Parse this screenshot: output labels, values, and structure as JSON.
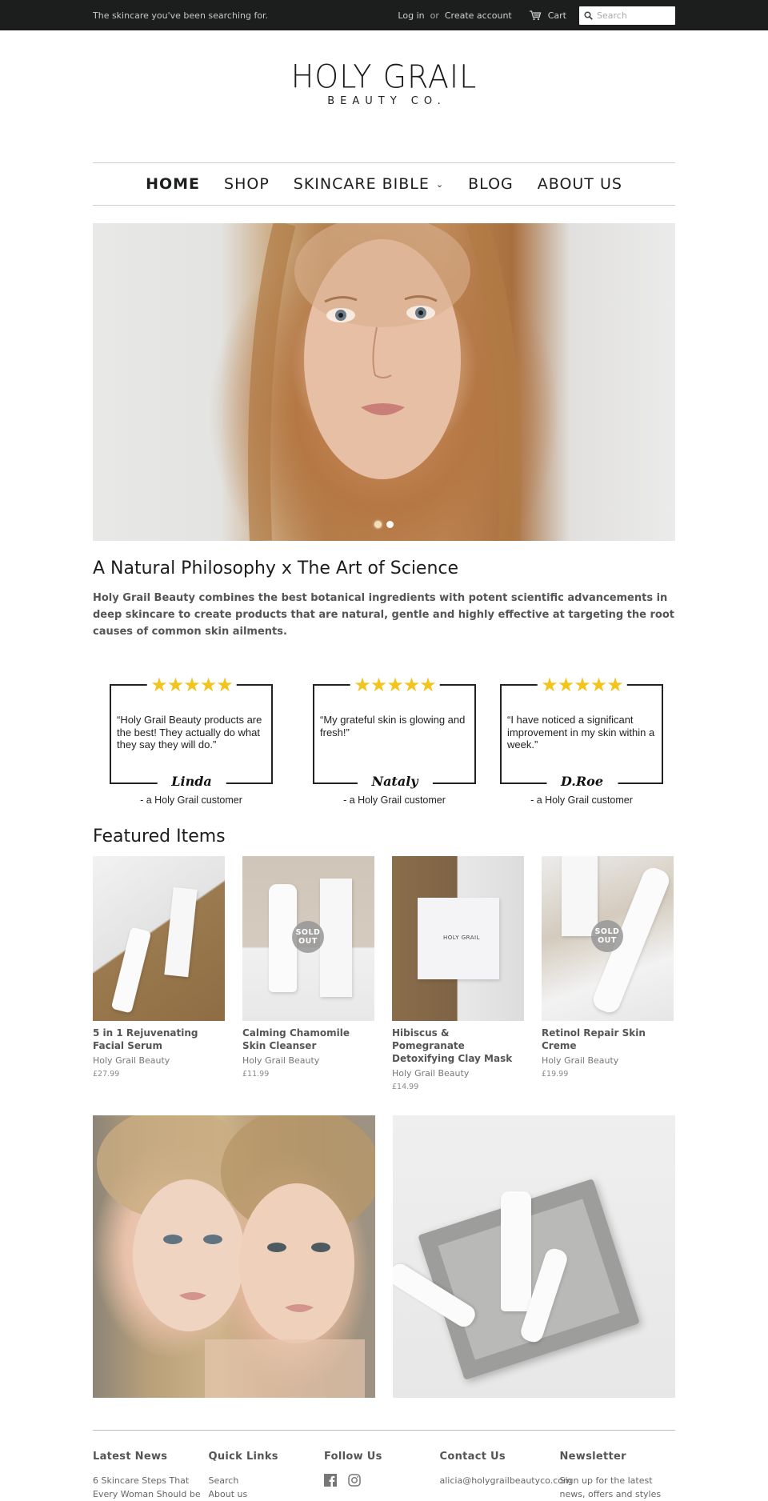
{
  "topbar": {
    "tagline": "The skincare you've been searching for.",
    "login": "Log in",
    "or": "or",
    "create_account": "Create account",
    "cart": "Cart",
    "search_placeholder": "Search"
  },
  "logo": {
    "line1": "HOLY GRAIL",
    "line2": "BEAUTY CO."
  },
  "nav": {
    "items": [
      {
        "label": "HOME",
        "active": true
      },
      {
        "label": "SHOP"
      },
      {
        "label": "SKINCARE BIBLE",
        "dropdown": true
      },
      {
        "label": "BLOG"
      },
      {
        "label": "ABOUT US"
      }
    ]
  },
  "hero": {
    "slides": 2,
    "active_slide": 1
  },
  "intro": {
    "heading": "A Natural Philosophy x The Art of Science",
    "body": "Holy Grail Beauty combines the best botanical ingredients with potent scientific advancements in deep skincare to create products that are natural, gentle and highly effective at targeting the root causes of common skin ailments."
  },
  "testimonials": [
    {
      "stars": "★★★★★",
      "rating": 5,
      "quote": "“Holy Grail Beauty products are the best! They actually do what they say they will do.”",
      "name": "Linda",
      "byline": "- a Holy Grail customer"
    },
    {
      "stars": "★★★★★",
      "rating": 5,
      "quote": "“My grateful skin is glowing and fresh!”",
      "name": "Nataly",
      "byline": "- a Holy Grail customer"
    },
    {
      "stars": "★★★★★",
      "rating": 5,
      "quote": "“I have noticed a significant improvement in my skin within a week.”",
      "name": "D.Roe",
      "byline": "- a Holy Grail customer"
    }
  ],
  "featured": {
    "heading": "Featured Items",
    "sold_out_label_1": "SOLD",
    "sold_out_label_2": "OUT",
    "brand_mark": "HOLY GRAIL",
    "products": [
      {
        "title": "5 in 1 Rejuvenating Facial Serum",
        "vendor": "Holy Grail Beauty",
        "price": "£27.99",
        "sold_out": false
      },
      {
        "title": "Calming Chamomile Skin Cleanser",
        "vendor": "Holy Grail Beauty",
        "price": "£11.99",
        "sold_out": true
      },
      {
        "title": "Hibiscus & Pomegranate Detoxifying Clay Mask",
        "vendor": "Holy Grail Beauty",
        "price": "£14.99",
        "sold_out": false
      },
      {
        "title": "Retinol Repair Skin Creme",
        "vendor": "Holy Grail Beauty",
        "price": "£19.99",
        "sold_out": true
      }
    ]
  },
  "footer": {
    "latest_news": {
      "heading": "Latest News",
      "item": "6 Skincare Steps That Every Woman Should be"
    },
    "quick_links": {
      "heading": "Quick Links",
      "links": [
        "Search",
        "About us"
      ]
    },
    "follow_us": {
      "heading": "Follow Us",
      "icons": [
        "facebook-icon",
        "instagram-icon"
      ]
    },
    "contact_us": {
      "heading": "Contact Us",
      "email": "alicia@holygrailbeautyco.com"
    },
    "newsletter": {
      "heading": "Newsletter",
      "text": "Sign up for the latest news, offers and styles"
    }
  }
}
